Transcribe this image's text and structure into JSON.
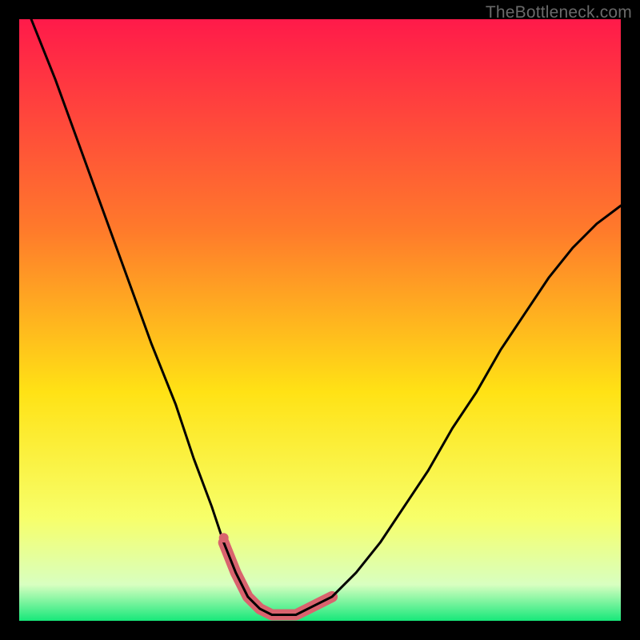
{
  "watermark": "TheBottleneck.com",
  "colors": {
    "gradient_top": "#ff1a4a",
    "gradient_mid1": "#ff7a2b",
    "gradient_mid2": "#ffe215",
    "gradient_mid3": "#f7ff6a",
    "gradient_bottom_pale": "#d8ffc0",
    "gradient_bottom": "#17e87a",
    "curve": "#000000",
    "marker": "#d9636e",
    "frame": "#000000"
  },
  "chart_data": {
    "type": "line",
    "title": "",
    "xlabel": "",
    "ylabel": "",
    "xlim": [
      0,
      100
    ],
    "ylim": [
      0,
      100
    ],
    "series": [
      {
        "name": "bottleneck-curve",
        "x": [
          2,
          6,
          10,
          14,
          18,
          22,
          26,
          29,
          32,
          34,
          36,
          38,
          40,
          42,
          44,
          46,
          48,
          52,
          56,
          60,
          64,
          68,
          72,
          76,
          80,
          84,
          88,
          92,
          96,
          100
        ],
        "y": [
          100,
          90,
          79,
          68,
          57,
          46,
          36,
          27,
          19,
          13,
          8,
          4,
          2,
          1,
          1,
          1,
          2,
          4,
          8,
          13,
          19,
          25,
          32,
          38,
          45,
          51,
          57,
          62,
          66,
          69
        ]
      }
    ],
    "markers": {
      "name": "highlight-range",
      "points": [
        {
          "x": 34,
          "y": 13
        },
        {
          "x": 36,
          "y": 8
        },
        {
          "x": 38,
          "y": 4
        },
        {
          "x": 40,
          "y": 2
        },
        {
          "x": 42,
          "y": 1
        },
        {
          "x": 44,
          "y": 1
        },
        {
          "x": 46,
          "y": 1
        },
        {
          "x": 48,
          "y": 2
        },
        {
          "x": 50,
          "y": 3
        },
        {
          "x": 52,
          "y": 4
        }
      ]
    }
  }
}
